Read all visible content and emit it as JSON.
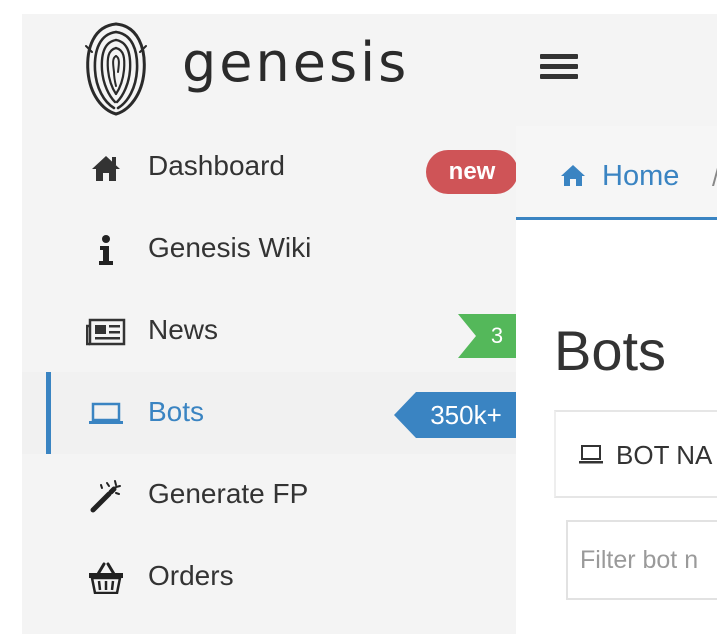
{
  "brand": {
    "name": "genesis"
  },
  "sidebar": {
    "items": [
      {
        "label": "Dashboard",
        "icon": "home-icon",
        "badge": "new"
      },
      {
        "label": "Genesis Wiki",
        "icon": "info-icon"
      },
      {
        "label": "News",
        "icon": "newspaper-icon",
        "badge": "3"
      },
      {
        "label": "Bots",
        "icon": "laptop-icon",
        "badge": "350k+",
        "active": true
      },
      {
        "label": "Generate FP",
        "icon": "magic-wand-icon"
      },
      {
        "label": "Orders",
        "icon": "basket-icon"
      }
    ]
  },
  "breadcrumb": {
    "home": "Home",
    "separator": "/"
  },
  "page": {
    "title": "Bots"
  },
  "tabs": {
    "first_label": "BOT NA"
  },
  "filter": {
    "placeholder": "Filter bot n"
  },
  "colors": {
    "accent": "#3a84c2",
    "badge_new": "#cf5457",
    "badge_news": "#54b85a",
    "sidebar_bg": "#f4f4f4"
  }
}
